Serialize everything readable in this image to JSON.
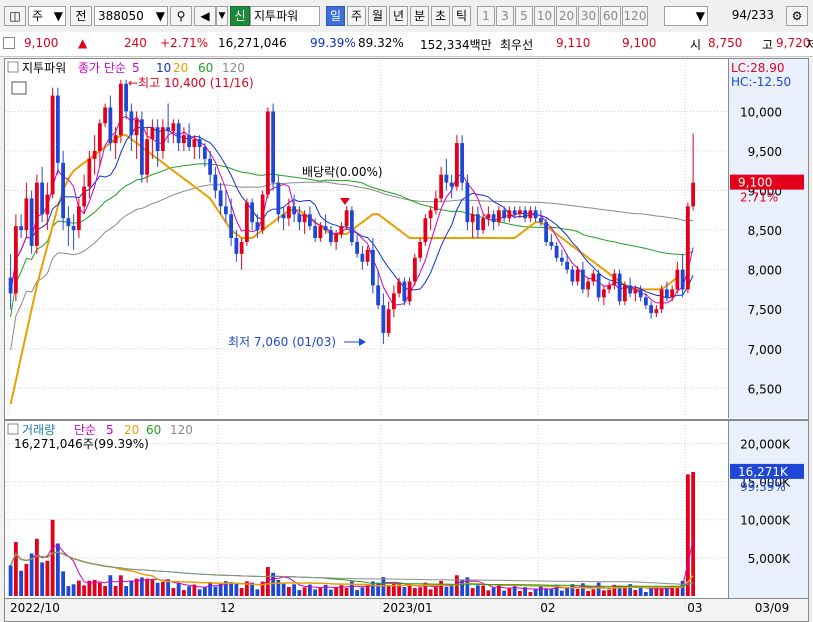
{
  "toolbar": {
    "market_code": "주",
    "type_label": "전",
    "stock_code": "388050",
    "new_badge": "신",
    "stock_name": "지투파워",
    "periods": [
      "일",
      "주",
      "월",
      "년",
      "분",
      "초",
      "틱"
    ],
    "minutes": [
      "1",
      "3",
      "5",
      "10",
      "20",
      "30",
      "60",
      "120"
    ],
    "page": "94",
    "page_total": "/233"
  },
  "quote": {
    "price": "9,100",
    "change": "240",
    "change_pct": "+2.71%",
    "volume": "16,271,046",
    "vol_ratio": "99.39%",
    "turnover_pct": "89.32%",
    "amount": "152,334백만",
    "best_ask_label": "최우선",
    "best_ask": "9,110",
    "best_bid": "9,100",
    "open_label": "시",
    "open": "8,750",
    "high_label": "고",
    "high": "9,720",
    "low_label": "저"
  },
  "colors": {
    "up": "#e3001b",
    "down": "#1f47d6",
    "ma5": "#d000c0",
    "ma10": "#1030d0",
    "ma20": "#e8a000",
    "ma60": "#20a020",
    "ma120": "#8a8a8a"
  },
  "chart_data": [
    {
      "type": "candlestick",
      "title": "지투파워",
      "legend": [
        "종가 단순",
        "5",
        "10",
        "20",
        "60",
        "120"
      ],
      "y_ticks": [
        6500,
        7000,
        7500,
        8000,
        8500,
        9000,
        9500,
        10000
      ],
      "y_tick_labels": [
        "6,500",
        "7,000",
        "7,500",
        "8,000",
        "8,500",
        "9,000",
        "9,500",
        "10,000"
      ],
      "ylim": [
        6150,
        10650
      ],
      "lc_label": "LC:28.90",
      "hc_label": "HC:-12.50",
      "last_price_label": "9,100",
      "last_pct_label": "2.71%",
      "annotations": {
        "high": "←최고 10,400 (11/16)",
        "low": "최저 7,060 (01/03)",
        "dividend": "배당락(0.00%)"
      },
      "x_ticks": [
        {
          "i": 0,
          "label": "2022/10"
        },
        {
          "i": 40,
          "label": "12"
        },
        {
          "i": 71,
          "label": "2023/01"
        },
        {
          "i": 101,
          "label": "02"
        },
        {
          "i": 129,
          "label": "03"
        }
      ],
      "x_end_label": "03/09",
      "ohlc": [
        [
          7900,
          8200,
          7500,
          7700
        ],
        [
          7700,
          8700,
          7600,
          8550
        ],
        [
          8550,
          8700,
          8400,
          8500
        ],
        [
          8500,
          9100,
          8400,
          8900
        ],
        [
          8900,
          9000,
          8200,
          8300
        ],
        [
          8300,
          9200,
          8200,
          9100
        ],
        [
          9100,
          9300,
          8600,
          8700
        ],
        [
          8700,
          9100,
          8500,
          8950
        ],
        [
          8950,
          10300,
          8900,
          10200
        ],
        [
          10200,
          10300,
          9200,
          9350
        ],
        [
          9350,
          9500,
          8500,
          8650
        ],
        [
          8650,
          8800,
          8300,
          8550
        ],
        [
          8550,
          8700,
          8250,
          8500
        ],
        [
          8500,
          8900,
          8400,
          8800
        ],
        [
          8800,
          9200,
          8700,
          9050
        ],
        [
          9050,
          9500,
          8900,
          9400
        ],
        [
          9400,
          9700,
          9200,
          9500
        ],
        [
          9500,
          9900,
          9300,
          9850
        ],
        [
          9850,
          10100,
          9800,
          10050
        ],
        [
          10050,
          10200,
          9500,
          9600
        ],
        [
          9600,
          9800,
          9400,
          9700
        ],
        [
          9700,
          10400,
          9600,
          10350
        ],
        [
          10350,
          10400,
          9900,
          10000
        ],
        [
          10000,
          10100,
          9500,
          9700
        ],
        [
          9700,
          10000,
          9400,
          9900
        ],
        [
          9900,
          10000,
          9100,
          9200
        ],
        [
          9200,
          9800,
          9100,
          9650
        ],
        [
          9650,
          9900,
          9400,
          9800
        ],
        [
          9800,
          9900,
          9300,
          9500
        ],
        [
          9500,
          9900,
          9400,
          9800
        ],
        [
          9800,
          10100,
          9600,
          9750
        ],
        [
          9750,
          9900,
          9600,
          9850
        ],
        [
          9850,
          9900,
          9500,
          9600
        ],
        [
          9600,
          9800,
          9500,
          9700
        ],
        [
          9700,
          9850,
          9500,
          9550
        ],
        [
          9550,
          9700,
          9400,
          9650
        ],
        [
          9650,
          9700,
          9400,
          9550
        ],
        [
          9550,
          9600,
          9300,
          9400
        ],
        [
          9400,
          9500,
          9100,
          9200
        ],
        [
          9200,
          9300,
          8900,
          9000
        ],
        [
          9000,
          9100,
          8700,
          8800
        ],
        [
          8800,
          9000,
          8600,
          8700
        ],
        [
          8700,
          8900,
          8300,
          8400
        ],
        [
          8400,
          8500,
          8100,
          8200
        ],
        [
          8200,
          8400,
          8000,
          8350
        ],
        [
          8350,
          8900,
          8300,
          8850
        ],
        [
          8850,
          8900,
          8500,
          8600
        ],
        [
          8600,
          8700,
          8400,
          8500
        ],
        [
          8500,
          9000,
          8450,
          8950
        ],
        [
          8950,
          10050,
          8900,
          10000
        ],
        [
          10000,
          10100,
          9000,
          9100
        ],
        [
          9100,
          9200,
          8600,
          8700
        ],
        [
          8700,
          8800,
          8500,
          8650
        ],
        [
          8650,
          8900,
          8550,
          8800
        ],
        [
          8800,
          8950,
          8600,
          8700
        ],
        [
          8700,
          8800,
          8500,
          8600
        ],
        [
          8600,
          8750,
          8450,
          8700
        ],
        [
          8700,
          8800,
          8500,
          8550
        ],
        [
          8550,
          8650,
          8350,
          8400
        ],
        [
          8400,
          8600,
          8350,
          8550
        ],
        [
          8550,
          8700,
          8450,
          8500
        ],
        [
          8500,
          8550,
          8300,
          8350
        ],
        [
          8350,
          8500,
          8250,
          8450
        ],
        [
          8450,
          8600,
          8400,
          8550
        ],
        [
          8550,
          8800,
          8500,
          8750
        ],
        [
          8750,
          8800,
          8300,
          8350
        ],
        [
          8350,
          8450,
          8150,
          8200
        ],
        [
          8200,
          8300,
          8000,
          8100
        ],
        [
          8100,
          8300,
          8050,
          8250
        ],
        [
          8250,
          8400,
          7700,
          7800
        ],
        [
          7800,
          8000,
          7500,
          7550
        ],
        [
          7550,
          7700,
          7060,
          7200
        ],
        [
          7200,
          7600,
          7150,
          7500
        ],
        [
          7500,
          7800,
          7400,
          7700
        ],
        [
          7700,
          7900,
          7650,
          7850
        ],
        [
          7850,
          7900,
          7550,
          7600
        ],
        [
          7600,
          7900,
          7550,
          7850
        ],
        [
          7850,
          8200,
          7800,
          8150
        ],
        [
          8150,
          8400,
          8100,
          8350
        ],
        [
          8350,
          8700,
          8300,
          8650
        ],
        [
          8650,
          8800,
          8500,
          8750
        ],
        [
          8750,
          9000,
          8700,
          8900
        ],
        [
          8900,
          9300,
          8850,
          9200
        ],
        [
          9200,
          9400,
          9000,
          9100
        ],
        [
          9100,
          9200,
          8900,
          9050
        ],
        [
          9050,
          9700,
          9000,
          9600
        ],
        [
          9600,
          9700,
          9000,
          9100
        ],
        [
          9100,
          9200,
          8500,
          8600
        ],
        [
          8600,
          8800,
          8400,
          8700
        ],
        [
          8700,
          8800,
          8400,
          8500
        ],
        [
          8500,
          8700,
          8450,
          8650
        ],
        [
          8650,
          8800,
          8550,
          8700
        ],
        [
          8700,
          8750,
          8500,
          8600
        ],
        [
          8600,
          8800,
          8550,
          8750
        ],
        [
          8750,
          8800,
          8600,
          8650
        ],
        [
          8650,
          8800,
          8600,
          8750
        ],
        [
          8750,
          8800,
          8650,
          8700
        ],
        [
          8700,
          8800,
          8650,
          8750
        ],
        [
          8750,
          8800,
          8600,
          8650
        ],
        [
          8650,
          8800,
          8600,
          8750
        ],
        [
          8750,
          8800,
          8600,
          8650
        ],
        [
          8650,
          8750,
          8550,
          8600
        ],
        [
          8600,
          8650,
          8300,
          8350
        ],
        [
          8350,
          8450,
          8250,
          8300
        ],
        [
          8300,
          8350,
          8100,
          8150
        ],
        [
          8150,
          8250,
          8050,
          8100
        ],
        [
          8100,
          8200,
          7950,
          8000
        ],
        [
          8000,
          8050,
          7800,
          7850
        ],
        [
          7850,
          8050,
          7800,
          8000
        ],
        [
          8000,
          8100,
          7700,
          7750
        ],
        [
          7750,
          7900,
          7650,
          7850
        ],
        [
          7850,
          8000,
          7800,
          7950
        ],
        [
          7950,
          8000,
          7600,
          7650
        ],
        [
          7650,
          7800,
          7550,
          7750
        ],
        [
          7750,
          7850,
          7700,
          7800
        ],
        [
          7800,
          8000,
          7750,
          7950
        ],
        [
          7950,
          8000,
          7550,
          7600
        ],
        [
          7600,
          7850,
          7550,
          7800
        ],
        [
          7800,
          7900,
          7650,
          7700
        ],
        [
          7700,
          7800,
          7600,
          7750
        ],
        [
          7750,
          7800,
          7600,
          7650
        ],
        [
          7650,
          7700,
          7500,
          7550
        ],
        [
          7550,
          7600,
          7380,
          7450
        ],
        [
          7450,
          7550,
          7400,
          7500
        ],
        [
          7500,
          7800,
          7450,
          7750
        ],
        [
          7750,
          7850,
          7600,
          7650
        ],
        [
          7650,
          7800,
          7600,
          7750
        ],
        [
          7750,
          8100,
          7700,
          8000
        ],
        [
          8000,
          8200,
          7650,
          7750
        ],
        [
          7750,
          8850,
          7700,
          8800
        ],
        [
          8800,
          9720,
          8750,
          9100
        ]
      ],
      "ma20": [
        6300,
        6600,
        6900,
        7200,
        7500,
        7800,
        8050,
        8300,
        8550,
        8800,
        9000,
        9150,
        9250,
        9300,
        9350,
        9400,
        9450,
        9500,
        9550,
        9600,
        9650,
        9700,
        9700,
        9650,
        9600,
        9550,
        9500,
        9450,
        9400,
        9350,
        9300,
        9250,
        9200,
        9150,
        9100,
        9050,
        9000,
        8950,
        8900,
        8800,
        8700,
        8600,
        8500,
        8450,
        8400,
        8400,
        8400,
        8450,
        8500,
        8550,
        8600,
        8650,
        8700,
        8750,
        8750,
        8750,
        8700,
        8650,
        8600,
        8550,
        8500,
        8450,
        8450,
        8450,
        8450,
        8500,
        8550,
        8600,
        8650,
        8700,
        8700,
        8650,
        8600,
        8550,
        8500,
        8450,
        8400,
        8400,
        8400,
        8400,
        8400,
        8400,
        8400,
        8400,
        8400,
        8400,
        8400,
        8400,
        8400,
        8400,
        8400,
        8400,
        8400,
        8400,
        8400,
        8400,
        8400,
        8450,
        8500,
        8550,
        8600,
        8600,
        8550,
        8500,
        8450,
        8400,
        8350,
        8300,
        8250,
        8200,
        8150,
        8100,
        8050,
        8000,
        7950,
        7900,
        7850,
        7800,
        7750,
        7750,
        7750,
        7750,
        7750,
        7750,
        7750,
        7800,
        7850,
        7900
      ]
    },
    {
      "type": "bar",
      "title": "거래량",
      "legend": [
        "단순",
        "5",
        "20",
        "60",
        "120"
      ],
      "info": "16,271,046주(99.39%)",
      "y_ticks": [
        5000000,
        10000000,
        15000000,
        20000000
      ],
      "y_tick_labels": [
        "5,000K",
        "10,000K",
        "15,000K",
        "20,000K"
      ],
      "ylim": [
        0,
        21500000
      ],
      "last_label": "16,271K",
      "last_pct_label": "99.39%",
      "last_volume": 16271046
    }
  ]
}
